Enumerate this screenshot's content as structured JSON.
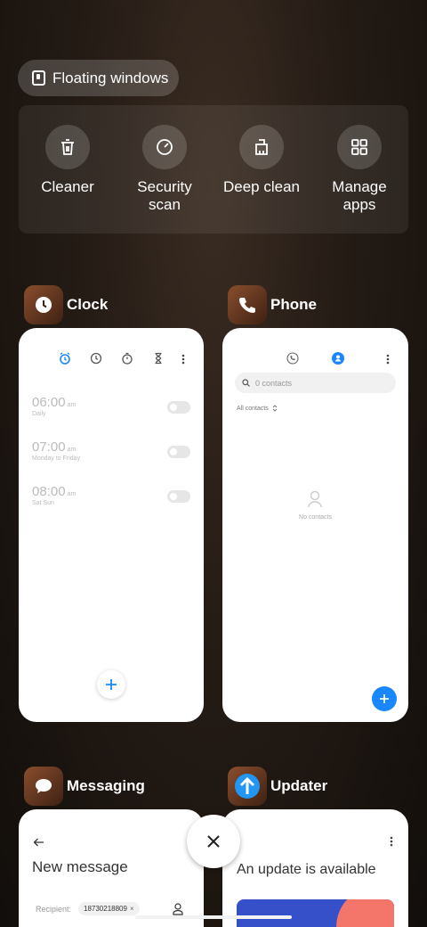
{
  "floating_windows": {
    "label": "Floating windows"
  },
  "tools": [
    {
      "label": "Cleaner",
      "icon": "trash-icon"
    },
    {
      "label": "Security scan",
      "icon": "security-scan-icon"
    },
    {
      "label": "Deep clean",
      "icon": "deep-clean-icon"
    },
    {
      "label": "Manage apps",
      "icon": "grid-icon"
    }
  ],
  "clock": {
    "name": "Clock",
    "alarms": [
      {
        "time": "06:00",
        "ampm": "am",
        "repeat": "Daily"
      },
      {
        "time": "07:00",
        "ampm": "am",
        "repeat": "Monday to Friday"
      },
      {
        "time": "08:00",
        "ampm": "am",
        "repeat": "Sat Sun"
      }
    ],
    "accent": "#1a86ff"
  },
  "phone": {
    "name": "Phone",
    "search_placeholder": "0 contacts",
    "filter": "All contacts",
    "empty": "No contacts",
    "accent": "#1a86ff"
  },
  "messaging": {
    "name": "Messaging",
    "title": "New message",
    "recipient_label": "Recipient:",
    "recipient_chip": "18730218809"
  },
  "updater": {
    "name": "Updater",
    "title": "An update is available"
  }
}
